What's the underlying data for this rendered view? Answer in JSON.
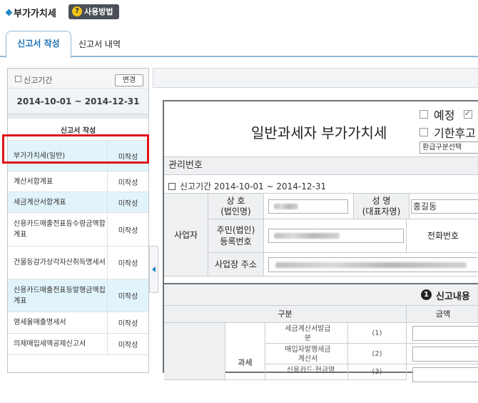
{
  "header": {
    "title": "부가가치세",
    "help_label": "사용방법",
    "help_icon": "?"
  },
  "tabs": [
    {
      "label": "신고서 작성",
      "active": true
    },
    {
      "label": "신고서 내역",
      "active": false
    }
  ],
  "left_panel": {
    "period_label": "신고기간",
    "change_button": "변경",
    "period": "2014-10-01 ~ 2014-12-31",
    "forms_header": "신고서 작성",
    "forms": [
      {
        "name": "부가가치세(일반)",
        "status": "미작성"
      },
      {
        "name": "계산서합계표",
        "status": "미작성"
      },
      {
        "name": "세금계산서합계표",
        "status": "미작성"
      },
      {
        "name": "신용카드매출전표등수령금액합계표",
        "status": "미작성"
      },
      {
        "name": "건물등감가상각자산취득명세서",
        "status": "미작성"
      },
      {
        "name": "신용카드매출전표등발행금액집계표",
        "status": "미작성"
      },
      {
        "name": "영세율매출명세서",
        "status": "미작성"
      },
      {
        "name": "의제매입세액공제신고서",
        "status": "미작성"
      }
    ]
  },
  "form": {
    "title": "일반과세자 부가가치세",
    "check_preliminary": "예정",
    "check_after_deadline": "기한후고",
    "refund_select": "환급구분선택",
    "mgmt_no_label": "관리번호",
    "report_period": "신고기간 2014-10-01 ~ 2014-12-31",
    "business_label": "사업자",
    "trade_name_label": "상 호\n(법인명)",
    "rep_name_label": "성 명\n(대표자명)",
    "rep_name_value": "홍길동",
    "reg_no_label": "주민(법인)\n등록번호",
    "phone_label": "전화번호",
    "address_label": "사업장 주소",
    "section_number": "1",
    "section_title": "신고내용",
    "col_category": "구분",
    "col_amount": "금액",
    "tax_label": "과세",
    "sub_rows": [
      {
        "label": "세금계산서발급분",
        "code": "(1)"
      },
      {
        "label": "매입자발행세금계산서",
        "code": "(2)"
      },
      {
        "label": "신용카드·현금영",
        "code": "(3)"
      }
    ]
  }
}
